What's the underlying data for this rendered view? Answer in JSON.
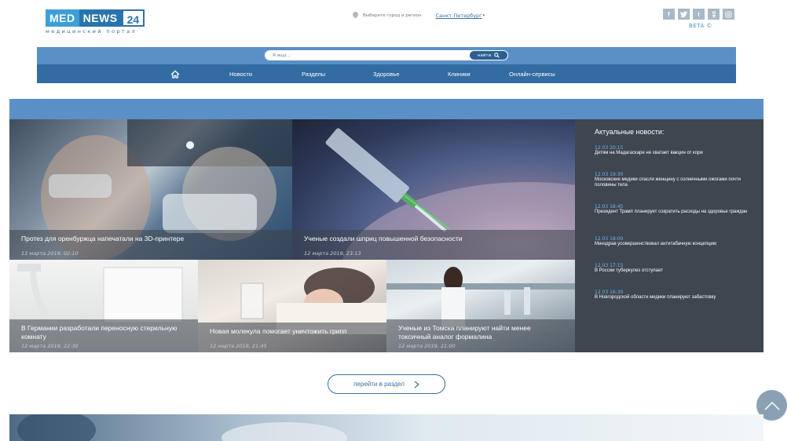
{
  "logo": {
    "part1": "MED",
    "part2": "NEWS",
    "part3": "24",
    "subtitle": "медицинский портал"
  },
  "region": {
    "label": "Выберите город и регион",
    "city": "Санкт-Петербург"
  },
  "socials": {
    "items": [
      "f",
      "t",
      "в",
      "ok",
      "ig"
    ],
    "icons": [
      "facebook-icon",
      "twitter-icon",
      "vk-icon",
      "odnoklassniki-icon",
      "instagram-icon"
    ]
  },
  "beta": "BETA ©",
  "search": {
    "placeholder": "Я ищу...",
    "button": "найти"
  },
  "nav": {
    "items": [
      "Новости",
      "Разделы",
      "Здоровье",
      "Клиники",
      "Онлайн-сервисы"
    ]
  },
  "tiles": [
    {
      "title": "Протез для оренбуржца напечатали на 3D-принтере",
      "date": "13 марта 2019, 02:10"
    },
    {
      "title": "Ученые создали шприц повышенной безопасности",
      "date": "12 марта 2019, 23:13"
    },
    {
      "title": "В Германии разработали переносную стерильную комнату",
      "date": "12 марта 2019, 22:30"
    },
    {
      "title": "Новая молекула помогает уничтожить грипп",
      "date": "12 марта 2019, 21:45"
    },
    {
      "title": "Ученые из Томска планируют найти менее токсичный аналог формалина",
      "date": "12 марта 2019, 21:00"
    }
  ],
  "sidebar": {
    "heading": "Актуальные новости:",
    "items": [
      {
        "time": "12.03 20:15",
        "text": "Детям на Мадагаскаре не хватает вакцин от кори"
      },
      {
        "time": "12.03 19:30",
        "text": "Московские медики спасли женщину с солнечными ожогами почти половины тела"
      },
      {
        "time": "12.03 18:45",
        "text": "Президент Трамп планирует сократить расходы на здоровье граждан"
      },
      {
        "time": "12.03 18:00",
        "text": "Минздрав усовершенствовал антитабачную концепцию"
      },
      {
        "time": "12.03 17:15",
        "text": "В России туберкулез отступает"
      },
      {
        "time": "12.03 16:30",
        "text": "В Новгородской области медики планируют забастовку"
      }
    ]
  },
  "more_button": "перейти в раздел",
  "colors": {
    "accent": "#336ba3",
    "light_accent": "#5b90c6",
    "sidebar_bg": "#3e4650",
    "time_color": "#6fb6ea"
  }
}
